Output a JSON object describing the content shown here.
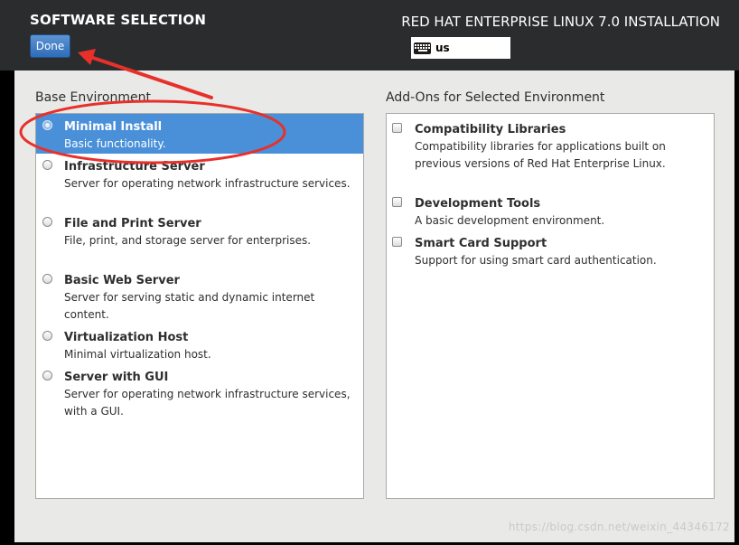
{
  "header": {
    "title": "SOFTWARE SELECTION",
    "done_label": "Done",
    "product_title": "RED HAT ENTERPRISE LINUX 7.0 INSTALLATION",
    "keyboard_layout": "us",
    "keyboard_icon": "keyboard-icon"
  },
  "base_environment": {
    "label": "Base Environment",
    "selected": "Minimal Install",
    "items": [
      {
        "title": "Minimal Install",
        "description": "Basic functionality."
      },
      {
        "title": "Infrastructure Server",
        "description": "Server for operating network infrastructure services."
      },
      {
        "title": "File and Print Server",
        "description": "File, print, and storage server for enterprises."
      },
      {
        "title": "Basic Web Server",
        "description": "Server for serving static and dynamic internet content."
      },
      {
        "title": "Virtualization Host",
        "description": "Minimal virtualization host."
      },
      {
        "title": "Server with GUI",
        "description": "Server for operating network infrastructure services, with a GUI."
      }
    ]
  },
  "addons": {
    "label": "Add-Ons for Selected Environment",
    "items": [
      {
        "title": "Compatibility Libraries",
        "description": "Compatibility libraries for applications built on previous versions of Red Hat Enterprise Linux.",
        "checked": false
      },
      {
        "title": "Development Tools",
        "description": "A basic development environment.",
        "checked": false
      },
      {
        "title": "Smart Card Support",
        "description": "Support for using smart card authentication.",
        "checked": false
      }
    ]
  },
  "annotation": {
    "color": "#e8302a"
  },
  "watermark": "https://blog.csdn.net/weixin_44346172",
  "colors": {
    "header_bg": "#2a2c2e",
    "selection": "#4a90d9",
    "content_bg": "#e9e9e7"
  }
}
